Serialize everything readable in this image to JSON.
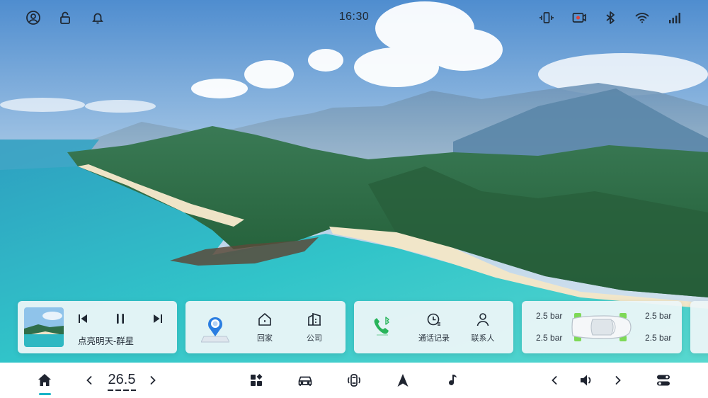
{
  "status_bar": {
    "time": "16:30",
    "left_icons": [
      "account-icon",
      "lock-icon",
      "bell-icon"
    ],
    "right_icons": [
      "phone-projection-icon",
      "dashcam-record-icon",
      "bluetooth-icon",
      "wifi-icon",
      "signal-icon"
    ]
  },
  "media": {
    "song": "点亮明天-群星",
    "controls": [
      "previous-icon",
      "pause-icon",
      "next-icon"
    ]
  },
  "navigation": {
    "home_label": "回家",
    "work_label": "公司"
  },
  "phone": {
    "call_log_label": "通话记录",
    "contacts_label": "联系人"
  },
  "tires": {
    "front_left": "2.5 bar",
    "rear_left": "2.5 bar",
    "front_right": "2.5 bar",
    "rear_right": "2.5 bar"
  },
  "dock": {
    "temperature": "26.5",
    "accent_color": "#16b3c7",
    "icons": [
      "home-icon",
      "apps-icon",
      "car-icon",
      "vehicle-status-icon",
      "navigation-arrow-icon",
      "music-note-icon",
      "volume-icon",
      "settings-toggle-icon"
    ]
  }
}
